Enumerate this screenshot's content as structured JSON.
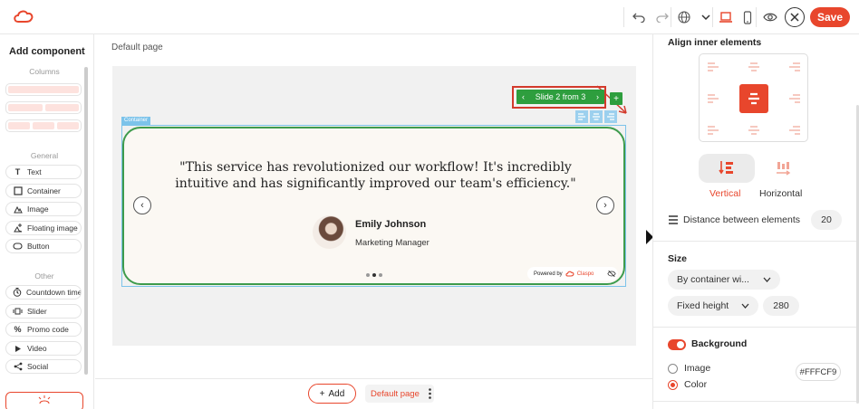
{
  "topbar": {
    "save_label": "Save",
    "icons": [
      "undo-icon",
      "redo-icon",
      "globe-icon",
      "chevron-down-icon",
      "laptop-icon",
      "mobile-icon",
      "eye-icon",
      "close-icon"
    ],
    "brand_color": "#e8462c"
  },
  "left_panel": {
    "title": "Add component",
    "columns_label": "Columns",
    "general_label": "General",
    "other_label": "Other",
    "general_items": [
      {
        "label": "Text",
        "icon": "text-icon"
      },
      {
        "label": "Container",
        "icon": "container-icon"
      },
      {
        "label": "Image",
        "icon": "image-icon"
      },
      {
        "label": "Floating image",
        "icon": "floating-image-icon"
      },
      {
        "label": "Button",
        "icon": "button-icon"
      }
    ],
    "other_items": [
      {
        "label": "Countdown timer",
        "icon": "timer-icon"
      },
      {
        "label": "Slider",
        "icon": "slider-icon"
      },
      {
        "label": "Promo code",
        "icon": "percent-icon"
      },
      {
        "label": "Video",
        "icon": "play-icon"
      },
      {
        "label": "Social",
        "icon": "share-icon"
      }
    ]
  },
  "canvas": {
    "page_label": "Default page",
    "slide_control": "Slide 2 from 3",
    "container_label": "Container",
    "quote": "\"This service has revolutionized our workflow! It's incredibly intuitive and has significantly improved our team's efficiency.\"",
    "person_name": "Emily Johnson",
    "person_role": "Marketing Manager",
    "powered_by": "Powered by",
    "powered_brand": "Claspo",
    "dots": 3,
    "active_dot": 2,
    "accent_green": "#2e9e3e",
    "highlight_red": "#d33a2c"
  },
  "bottombar": {
    "add_label": "Add",
    "page_chip": "Default page"
  },
  "right_panel": {
    "align_title": "Align inner elements",
    "vertical_label": "Vertical",
    "horizontal_label": "Horizontal",
    "distance_label": "Distance between elements",
    "distance_value": "20",
    "size_title": "Size",
    "width_mode": "By container wi...",
    "height_mode": "Fixed height",
    "height_value": "280",
    "background_title": "Background",
    "background_on": true,
    "bg_image_label": "Image",
    "bg_color_label": "Color",
    "bg_color_value": "#FFFCF9"
  }
}
